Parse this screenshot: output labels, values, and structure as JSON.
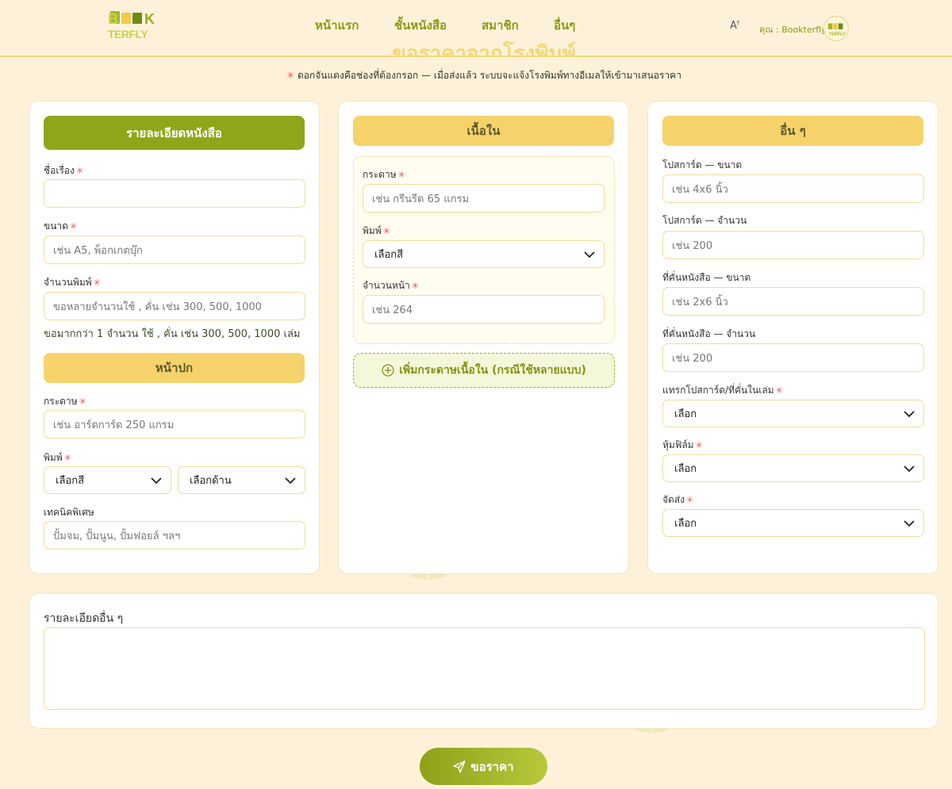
{
  "header": {
    "logo_text": "BOOK TERFLY",
    "nav": [
      "หน้าแรก",
      "ชั้นหนังสือ",
      "สมาชิก",
      "อื่นๆ"
    ],
    "font_icon": "Aᶠ",
    "user_label": "คุณ : Bookterfly"
  },
  "page": {
    "title": "ขอราคาจากโรงพิมพ์",
    "subtitle": "ดอกจันแดงคือช่องที่ต้องกรอก — เมื่อส่งแล้ว ระบบจะแจ้งโรงพิมพ์ทางอีเมลให้เข้ามาเสนอราคา",
    "required_mark": "✳"
  },
  "book_card": {
    "header": "รายละเอียดหนังสือ",
    "title_label": "ชื่อเรื่อง",
    "title_value": "",
    "size_label": "ขนาด",
    "size_placeholder": "เช่น A5, พ็อกเกตบุ๊ก",
    "qty_label": "จำนวนพิมพ์",
    "qty_placeholder": "ขอหลายจำนวนใช้ , คั่น เช่น 300, 500, 1000",
    "qty_hint": "ขอมากกว่า 1 จำนวน ใช้ , คั่น เช่น 300, 500, 1000 เล่ม",
    "cover_header": "หน้าปก",
    "paper_label": "กระดาษ",
    "paper_placeholder": "เช่น อาร์ตการ์ด 250 แกรม",
    "print_label": "พิมพ์",
    "print_color_value": "เลือกสี",
    "print_side_value": "เลือกด้าน",
    "special_label": "เทคนิคพิเศษ",
    "special_placeholder": "ปั้มจม, ปั้มนูน, ปั้มฟอยล์ ฯลฯ"
  },
  "content_card": {
    "header": "เนื้อใน",
    "paper_label": "กระดาษ",
    "paper_placeholder": "เช่น กรีนรีด 65 แกรม",
    "print_label": "พิมพ์",
    "print_value": "เลือกสี",
    "pages_label": "จำนวนหน้า",
    "pages_placeholder": "เช่น 264",
    "add_button": "เพิ่มกระดาษเนื้อใน (กรณีใช้หลายแบบ)"
  },
  "other_card": {
    "header": "อื่น ๆ",
    "postcard_size_label": "โปสการ์ด — ขนาด",
    "postcard_size_placeholder": "เช่น 4x6 นิ้ว",
    "postcard_qty_label": "โปสการ์ด — จำนวน",
    "postcard_qty_placeholder": "เช่น 200",
    "bookmark_size_label": "ที่คั่นหนังสือ — ขนาด",
    "bookmark_size_placeholder": "เช่น 2x6 นิ้ว",
    "bookmark_qty_label": "ที่คั่นหนังสือ — จำนวน",
    "bookmark_qty_placeholder": "เช่น 200",
    "insert_label": "แทรกโปสการ์ด/ที่คั่นในเล่ม",
    "insert_value": "เลือก",
    "film_label": "หุ้มฟิล์ม",
    "film_value": "เลือก",
    "shipping_label": "จัดส่ง",
    "shipping_value": "เลือก"
  },
  "details": {
    "label": "รายละเอียดอื่น ๆ",
    "value": ""
  },
  "submit_label": "ขอราคา",
  "colors": {
    "olive": "#8fa51a",
    "yellow": "#f6d26b",
    "background": "#fdf2d9",
    "required": "#e35656"
  }
}
